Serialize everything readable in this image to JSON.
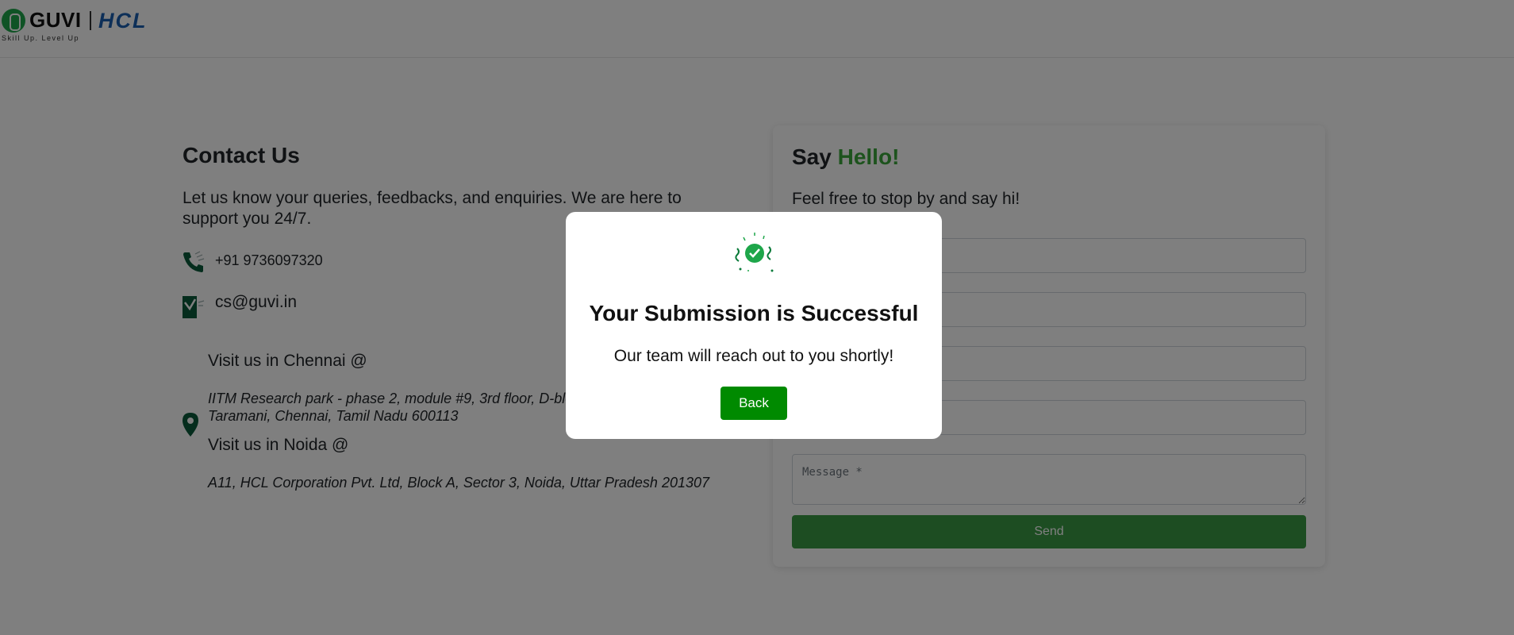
{
  "header": {
    "brand": "GUVI",
    "partner": "HCL",
    "tagline": "Skill Up. Level Up"
  },
  "contact": {
    "title": "Contact Us",
    "description": "Let us know your queries, feedbacks, and enquiries. We are here to support you 24/7.",
    "phone": "+91 9736097320",
    "email": "cs@guvi.in",
    "chennai_title": "Visit us in Chennai @",
    "chennai_address": "IITM Research park - phase 2, module #9, 3rd floor, D-block, Kanagam Rd, Taramani, Chennai, Tamil Nadu 600113",
    "noida_title": "Visit us in Noida @",
    "noida_address": "A11, HCL Corporation Pvt. Ltd, Block A, Sector 3, Noida, Uttar Pradesh 201307"
  },
  "form": {
    "title_plain": "Say ",
    "title_highlight": "Hello!",
    "subtitle": "Feel free to stop by and say hi!",
    "message_placeholder": "Message *",
    "send_label": "Send"
  },
  "modal": {
    "title": "Your Submission is Successful",
    "text": "Our team will reach out to you shortly!",
    "back_label": "Back"
  },
  "colors": {
    "brand_green": "#1ea64a",
    "hcl_blue": "#1b5fb0",
    "accent_green": "#3aa63a",
    "button_green": "#008a00"
  }
}
